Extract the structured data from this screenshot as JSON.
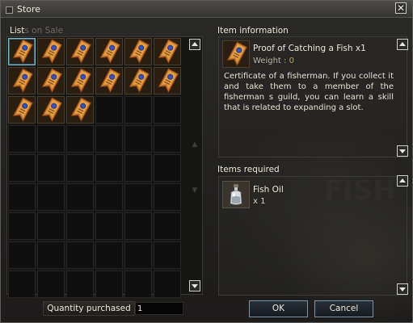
{
  "window": {
    "title": "Store"
  },
  "list": {
    "title_visible": "List",
    "title_obscured": "s on Sale",
    "item_count": 15,
    "item_icon": "fish-certificate-icon",
    "selected_index": 0
  },
  "info": {
    "title": "Item information",
    "item_name": "Proof of Catching a Fish x1",
    "weight_label": "Weight : ",
    "weight_value": "0",
    "description": "Certificate of a fisherman. If you collect it and take them to a member of the fisherman    s guild, you can learn a skill that is related to expanding a slot."
  },
  "required": {
    "title": "Items required",
    "item_name": "Fish Oil",
    "quantity": "x 1"
  },
  "footer": {
    "quantity_label": "Quantity purchased",
    "quantity_value": "1",
    "ok_label": "OK",
    "cancel_label": "Cancel"
  },
  "colors": {
    "accent_blue": "#7fb6c8",
    "weight_gold": "#c9a23e",
    "ticket_orange": "#c9762a"
  }
}
